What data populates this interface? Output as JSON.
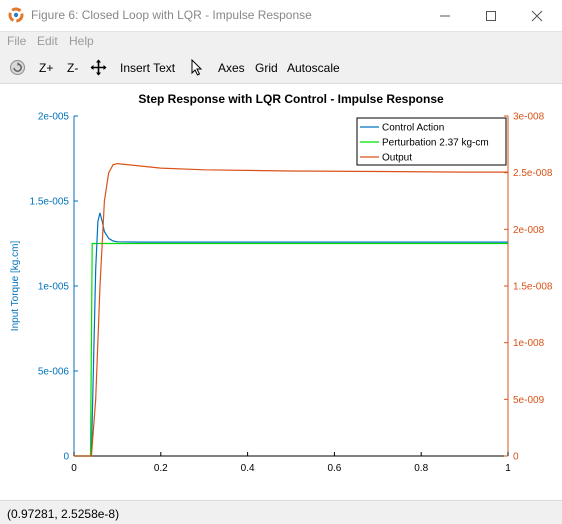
{
  "window": {
    "title": "Figure 6: Closed Loop with LQR - Impulse Response",
    "controls": {
      "minimize": "minimize-icon",
      "maximize": "maximize-icon",
      "close": "close-icon"
    }
  },
  "menu": [
    "File",
    "Edit",
    "Help"
  ],
  "toolbar": {
    "rotate_icon": "rotate-icon",
    "zoom_in": "Z+",
    "zoom_out": "Z-",
    "pan_icon": "pan-icon",
    "insert_text": "Insert Text",
    "select_icon": "pointer-icon",
    "axes": "Axes",
    "grid": "Grid",
    "autoscale": "Autoscale"
  },
  "status": {
    "coordinates": "(0.97281, 2.5258e-8)"
  },
  "colors": {
    "left_axis": "#0072bd",
    "right_axis": "#d95319",
    "control_action": "#0072bd",
    "perturbation": "#00e000",
    "output": "#d95319"
  },
  "chart_data": {
    "type": "line",
    "title": "Step Response with LQR Control - Impulse Response",
    "xlabel": "",
    "ylabel_left": "Input Torque [kg.cm]",
    "ylabel_right": "",
    "xlim": [
      0,
      1
    ],
    "ylim_left": [
      0,
      2e-05
    ],
    "ylim_right": [
      0,
      3e-08
    ],
    "x_ticks": [
      "0",
      "0.2",
      "0.4",
      "0.6",
      "0.8",
      "1"
    ],
    "y_left_ticks": [
      "0",
      "5e-006",
      "1e-005",
      "1.5e-005",
      "2e-005"
    ],
    "y_right_ticks": [
      "0",
      "5e-009",
      "1e-008",
      "1.5e-008",
      "2e-008",
      "2.5e-008",
      "3e-008"
    ],
    "legend_position": "top-right",
    "series": [
      {
        "name": "Control Action",
        "axis": "left",
        "x": [
          0,
          0.04,
          0.05,
          0.055,
          0.06,
          0.065,
          0.07,
          0.08,
          0.09,
          0.1,
          0.15,
          0.3,
          0.5,
          0.7,
          1.0
        ],
        "y": [
          0,
          0,
          1.1e-05,
          1.38e-05,
          1.43e-05,
          1.38e-05,
          1.32e-05,
          1.28e-05,
          1.265e-05,
          1.26e-05,
          1.258e-05,
          1.258e-05,
          1.258e-05,
          1.258e-05,
          1.258e-05
        ]
      },
      {
        "name": "Perturbation 2.37 kg-cm",
        "axis": "left",
        "x": [
          0,
          0.038,
          0.042,
          1.0
        ],
        "y": [
          0,
          0,
          1.25e-05,
          1.25e-05
        ]
      },
      {
        "name": "Output",
        "axis": "right",
        "x": [
          0,
          0.04,
          0.05,
          0.06,
          0.07,
          0.08,
          0.09,
          0.1,
          0.15,
          0.2,
          0.3,
          0.5,
          0.7,
          0.9,
          1.0
        ],
        "y": [
          0,
          0,
          5e-09,
          1.5e-08,
          2.25e-08,
          2.5e-08,
          2.57e-08,
          2.58e-08,
          2.56e-08,
          2.54e-08,
          2.525e-08,
          2.515e-08,
          2.51e-08,
          2.505e-08,
          2.505e-08
        ]
      }
    ]
  }
}
